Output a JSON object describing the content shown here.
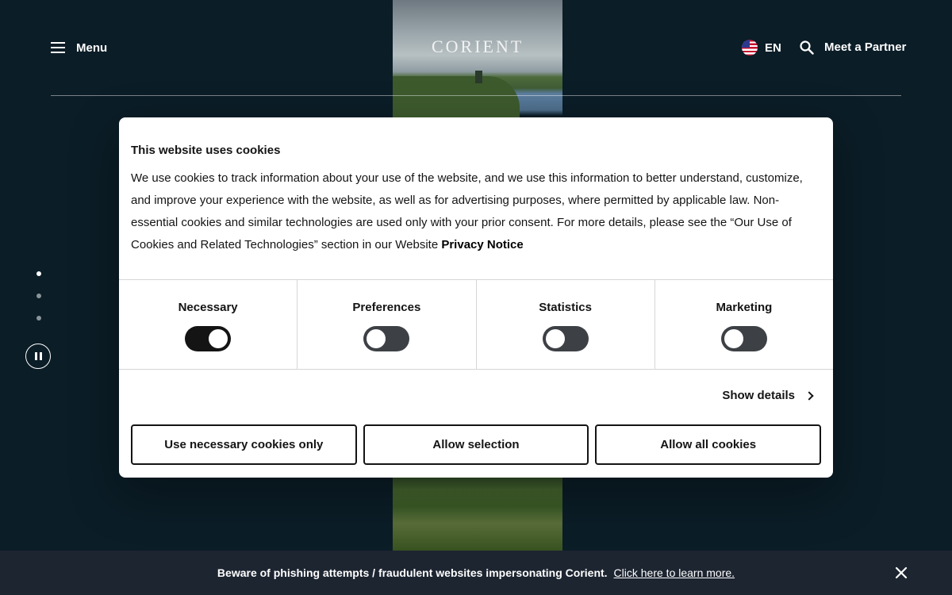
{
  "header": {
    "menu_label": "Menu",
    "logo_text": "CORIENT",
    "language_label": "EN",
    "partner_label": "Meet a Partner"
  },
  "slider": {
    "slide_count": 3,
    "active_slide": 1,
    "playback": "playing"
  },
  "cookie_dialog": {
    "title": "This website uses cookies",
    "body": "We use cookies to track information about your use of the website, and we use this information to better understand, customize, and improve your experience with the website, as well as for advertising purposes, where permitted by applicable law. Non-essential cookies and similar technologies are used only with your prior consent. For more details, please see the “Our Use of Cookies and Related Technologies” section in our Website ",
    "privacy_link": "Privacy Notice",
    "categories": [
      {
        "label": "Necessary",
        "enabled": true
      },
      {
        "label": "Preferences",
        "enabled": false
      },
      {
        "label": "Statistics",
        "enabled": false
      },
      {
        "label": "Marketing",
        "enabled": false
      }
    ],
    "show_details": "Show details",
    "buttons": {
      "necessary_only": "Use necessary cookies only",
      "allow_selection": "Allow selection",
      "allow_all": "Allow all cookies"
    }
  },
  "banner": {
    "text": "Beware of phishing attempts / fraudulent websites impersonating Corient.",
    "link": "Click here to learn more."
  },
  "colors": {
    "page_background": "#0b1d27",
    "banner_background": "#1d2531",
    "toggle_on": "#141414",
    "toggle_off": "#3d4045"
  }
}
